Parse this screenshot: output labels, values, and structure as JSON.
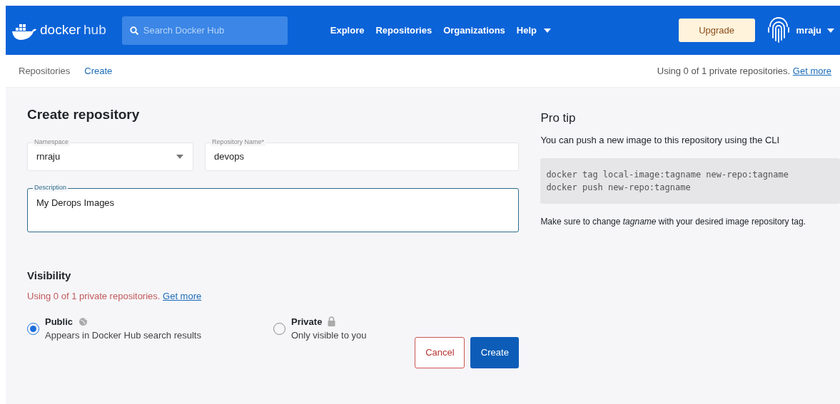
{
  "navbar": {
    "brand": {
      "name": "docker",
      "suffix": "hub"
    },
    "search": {
      "placeholder": "Search Docker Hub"
    },
    "links": [
      {
        "label": "Explore",
        "dropdown": false
      },
      {
        "label": "Repositories",
        "dropdown": false
      },
      {
        "label": "Organizations",
        "dropdown": false
      },
      {
        "label": "Help",
        "dropdown": true
      }
    ],
    "upgrade": "Upgrade",
    "user": "mraju"
  },
  "breadcrumb": {
    "items": [
      {
        "label": "Repositories",
        "selected": false
      },
      {
        "label": "Create",
        "selected": true
      }
    ],
    "usage": "Using 0 of 1 private repositories.",
    "usage_link": "Get more"
  },
  "form": {
    "title": "Create repository",
    "namespace": {
      "label": "Namespace",
      "value": "rnraju"
    },
    "repo_name": {
      "label": "Repository Name*",
      "value": "devops"
    },
    "description": {
      "label": "Description",
      "value": "My Derops Images"
    },
    "visibility": {
      "title": "Visibility",
      "usage": "Using 0 of 1 private repositories.",
      "usage_link": "Get more",
      "options": [
        {
          "label": "Public",
          "kind": "globe",
          "hint": "Appears in Docker Hub search results",
          "selected": true
        },
        {
          "label": "Private",
          "kind": "lock",
          "hint": "Only visible to you",
          "selected": false
        }
      ]
    },
    "buttons": [
      {
        "label": "Cancel",
        "kind": "outline"
      },
      {
        "label": "Create",
        "kind": "primary"
      }
    ]
  },
  "pro_tip": {
    "title": "Pro tip",
    "intro": "You can push a new image to this repository using the CLI",
    "code": [
      "docker tag local-image:tagname new-repo:tagname",
      "docker push new-repo:tagname"
    ],
    "note": "Make sure to change *tagname* with your desired image repository tag."
  }
}
